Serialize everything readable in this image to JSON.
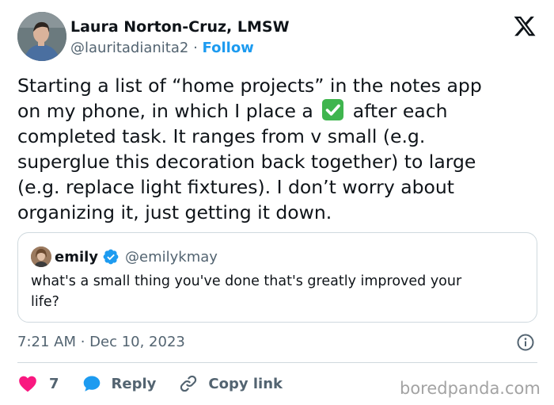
{
  "author": {
    "name": "Laura Norton-Cruz, LMSW",
    "handle": "@lauritadianita2",
    "separator": "·",
    "follow_label": "Follow"
  },
  "tweet": {
    "lines": [
      {
        "text": "Starting a list of “home projects” in the notes app"
      },
      {
        "before": "on my phone, in which I place a",
        "emoji": "check-mark-button",
        "after": "after each"
      },
      {
        "text": "completed task. It ranges from v small (e.g."
      },
      {
        "text": "superglue this decoration back together) to large"
      },
      {
        "text": "(e.g. replace light fixtures). I don’t worry about"
      },
      {
        "text": "organizing it, just getting it down."
      }
    ]
  },
  "quote": {
    "name": "emily",
    "handle": "@emilykmay",
    "lines": [
      "what's a small thing you've done that's greatly improved your",
      "life?"
    ]
  },
  "timestamp": "7:21 AM · Dec 10, 2023",
  "actions": {
    "like_count": "7",
    "reply_label": "Reply",
    "copy_label": "Copy link"
  },
  "watermark": "boredpanda.com",
  "colors": {
    "text": "#0f1419",
    "secondary": "#536471",
    "accent": "#1d9bf0",
    "like": "#f91880",
    "check": "#3fb54e",
    "border": "#cfd9de"
  },
  "icons": [
    "x-logo-icon",
    "verified-badge-icon",
    "info-icon",
    "heart-icon",
    "reply-bubble-icon",
    "link-icon",
    "check-mark-emoji"
  ]
}
